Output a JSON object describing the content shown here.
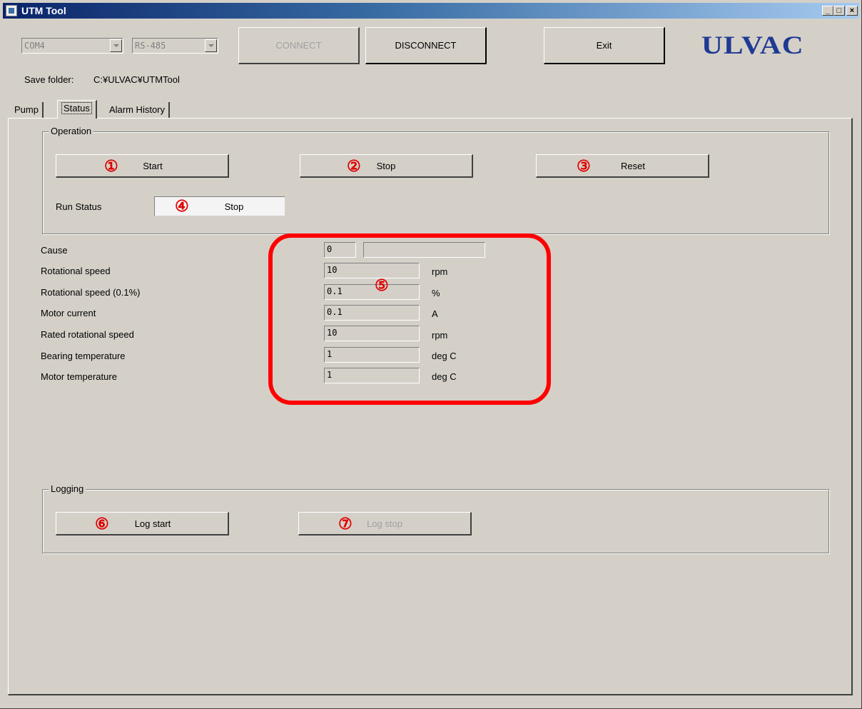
{
  "window": {
    "title": "UTM Tool",
    "minimize": "_",
    "maximize": "□",
    "close": "×"
  },
  "connection": {
    "port": "COM4",
    "interface": "RS-485",
    "connect_label": "CONNECT",
    "disconnect_label": "DISCONNECT",
    "exit_label": "Exit"
  },
  "logo_text": "ULVAC",
  "save_folder": {
    "label": "Save folder:",
    "path": "C:¥ULVAC¥UTMTool"
  },
  "tabs": [
    {
      "label": "Pump"
    },
    {
      "label": "Status"
    },
    {
      "label": "Alarm History"
    }
  ],
  "operation": {
    "title": "Operation",
    "start_label": "Start",
    "stop_label": "Stop",
    "reset_label": "Reset",
    "run_status_label": "Run Status",
    "run_status_value": "Stop"
  },
  "status_fields": [
    {
      "label": "Cause",
      "value": "0",
      "unit": ""
    },
    {
      "label": "Rotational speed",
      "value": "10",
      "unit": "rpm"
    },
    {
      "label": "Rotational speed (0.1%)",
      "value": "0.1",
      "unit": "%"
    },
    {
      "label": "Motor current",
      "value": "0.1",
      "unit": "A"
    },
    {
      "label": "Rated rotational speed",
      "value": "10",
      "unit": "rpm"
    },
    {
      "label": "Bearing temperature",
      "value": "1",
      "unit": "deg C"
    },
    {
      "label": "Motor temperature",
      "value": "1",
      "unit": "deg C"
    }
  ],
  "cause_text": "",
  "logging": {
    "title": "Logging",
    "log_start_label": "Log start",
    "log_stop_label": "Log stop"
  },
  "annotations": [
    "①",
    "②",
    "③",
    "④",
    "⑤",
    "⑥",
    "⑦"
  ],
  "colors": {
    "annotation_red": "#ff0000",
    "logo_blue": "#1f3a93",
    "title_gradient_start": "#0a246a"
  }
}
